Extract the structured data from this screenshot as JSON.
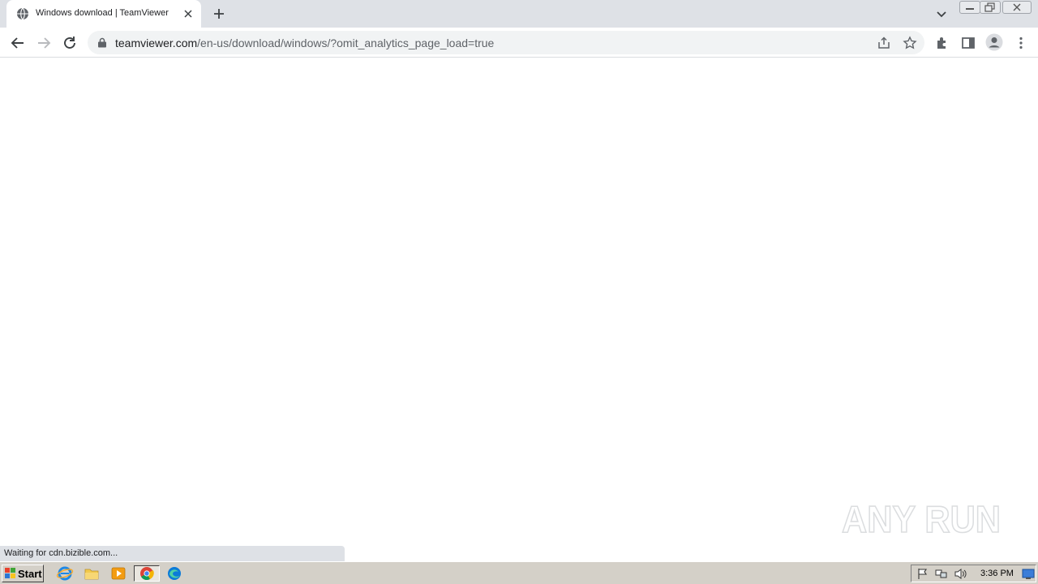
{
  "browser": {
    "tab": {
      "title": "Windows download | TeamViewer"
    },
    "url": {
      "host": "teamviewer.com",
      "path": "/en-us/download/windows/?omit_analytics_page_load=true"
    },
    "status_text": "Waiting for cdn.bizible.com...",
    "icons": {
      "favicon": "globe-icon",
      "tab_close": "close-icon",
      "new_tab": "plus-icon",
      "tab_search": "chevron-down-icon",
      "back": "arrow-left-icon",
      "forward": "arrow-right-icon",
      "reload": "reload-icon",
      "lock": "lock-icon",
      "share": "share-icon",
      "bookmark": "star-icon",
      "extensions": "puzzle-icon",
      "side_panel": "side-panel-icon",
      "profile": "profile-icon",
      "menu": "kebab-menu-icon"
    },
    "colors": {
      "tab_strip": "#dee1e6",
      "omnibox": "#f1f3f4"
    }
  },
  "watermark": {
    "text": "ANY RUN"
  },
  "taskbar": {
    "start_label": "Start",
    "clock": "3:36 PM",
    "apps": [
      "internet-explorer-icon",
      "folder-icon",
      "media-player-icon",
      "chrome-icon",
      "edge-icon"
    ],
    "tray": [
      "flag-icon",
      "network-icon",
      "volume-icon",
      "show-desktop-icon"
    ],
    "colors": {
      "taskbar": "#d4d0c8"
    }
  }
}
